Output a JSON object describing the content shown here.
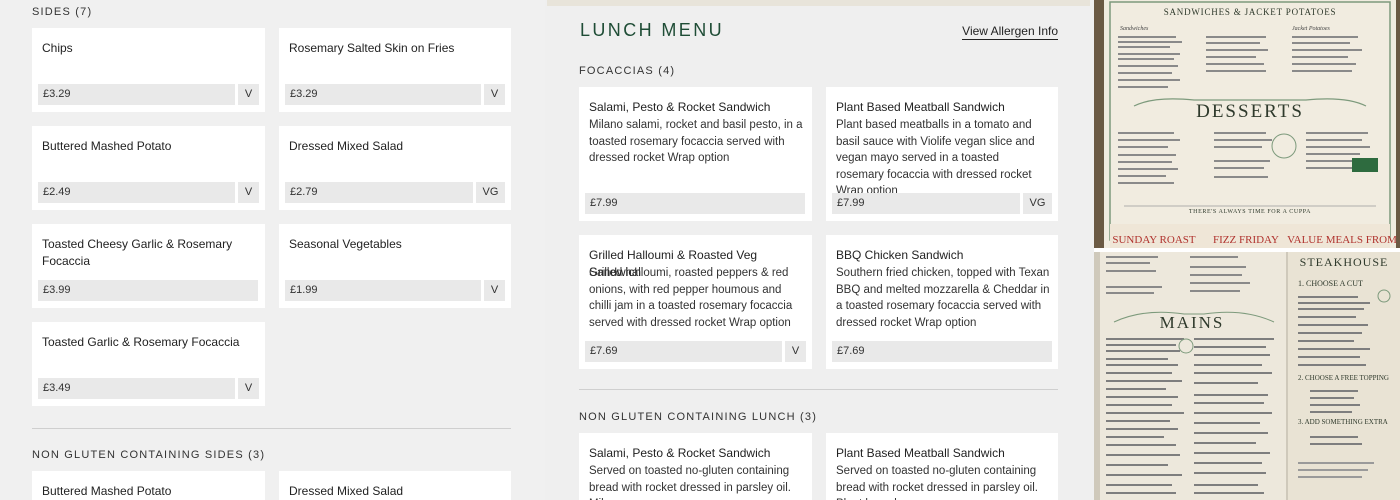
{
  "left": {
    "sides_heading": "SIDES (7)",
    "sides": [
      {
        "name": "Chips",
        "price": "£3.29",
        "diet": "V"
      },
      {
        "name": "Rosemary Salted Skin on Fries",
        "price": "£3.29",
        "diet": "V"
      },
      {
        "name": "Buttered Mashed Potato",
        "price": "£2.49",
        "diet": "V"
      },
      {
        "name": "Dressed Mixed Salad",
        "price": "£2.79",
        "diet": "VG"
      },
      {
        "name": "Toasted Cheesy Garlic & Rosemary Focaccia",
        "price": "£3.99",
        "diet": ""
      },
      {
        "name": "Seasonal Vegetables",
        "price": "£1.99",
        "diet": "V"
      },
      {
        "name": "Toasted Garlic & Rosemary Focaccia",
        "price": "£3.49",
        "diet": "V"
      }
    ],
    "ng_sides_heading": "NON GLUTEN CONTAINING SIDES (3)",
    "ng_sides": [
      {
        "name": "Buttered Mashed Potato"
      },
      {
        "name": "Dressed Mixed Salad"
      }
    ]
  },
  "middle": {
    "title": "LUNCH MENU",
    "allergen_link": "View Allergen Info",
    "focaccias_heading": "FOCACCIAS (4)",
    "focaccias": [
      {
        "name": "Salami, Pesto & Rocket Sandwich",
        "desc": "Milano salami, rocket and basil pesto, in a toasted rosemary focaccia served with dressed rocket Wrap option",
        "price": "£7.99",
        "diet": ""
      },
      {
        "name": "Plant Based Meatball Sandwich",
        "desc": "Plant based meatballs in a tomato and basil sauce with Violife vegan slice and vegan mayo served in a toasted rosemary focaccia with dressed rocket Wrap option",
        "price": "£7.99",
        "diet": "VG"
      },
      {
        "name": "Grilled Halloumi & Roasted Veg Sandwich",
        "desc": "Grilled halloumi, roasted peppers & red onions, with red pepper houmous and chilli jam in a toasted rosemary focaccia served with dressed rocket Wrap option",
        "price": "£7.69",
        "diet": "V"
      },
      {
        "name": "BBQ Chicken Sandwich",
        "desc": "Southern fried chicken, topped with Texan BBQ and melted mozzarella & Cheddar in a toasted rosemary focaccia served with dressed rocket Wrap option",
        "price": "£7.69",
        "diet": ""
      }
    ],
    "ng_lunch_heading": "NON GLUTEN CONTAINING LUNCH (3)",
    "ng_lunch": [
      {
        "name": "Salami, Pesto & Rocket Sandwich",
        "desc": "Served on toasted no-gluten containing bread with rocket dressed in parsley oil. Milano"
      },
      {
        "name": "Plant Based Meatball Sandwich",
        "desc": "Served on toasted no-gluten containing bread with rocket dressed in parsley oil. Plant based"
      }
    ]
  },
  "right": {
    "upper": {
      "header": "SANDWICHES & JACKET POTATOES",
      "sandwiches": "Sandwiches",
      "jacket": "Jacket Potatoes",
      "desserts": "DESSERTS",
      "cuppa": "THERE'S ALWAYS TIME FOR A CUPPA",
      "footer": [
        "SUNDAY ROAST",
        "FIZZ FRIDAY",
        "VALUE MEALS FROM"
      ]
    },
    "lower": {
      "mains": "MAINS",
      "steakhouse": "STEAKHOUSE",
      "step1": "1. CHOOSE A CUT",
      "step2": "2. CHOOSE A FREE TOPPING",
      "step3": "3. ADD SOMETHING EXTRA"
    }
  },
  "colors": {
    "accent": "#1f4d36",
    "price_bg": "#e9e9e9",
    "sunday_red": "#b0332e"
  }
}
